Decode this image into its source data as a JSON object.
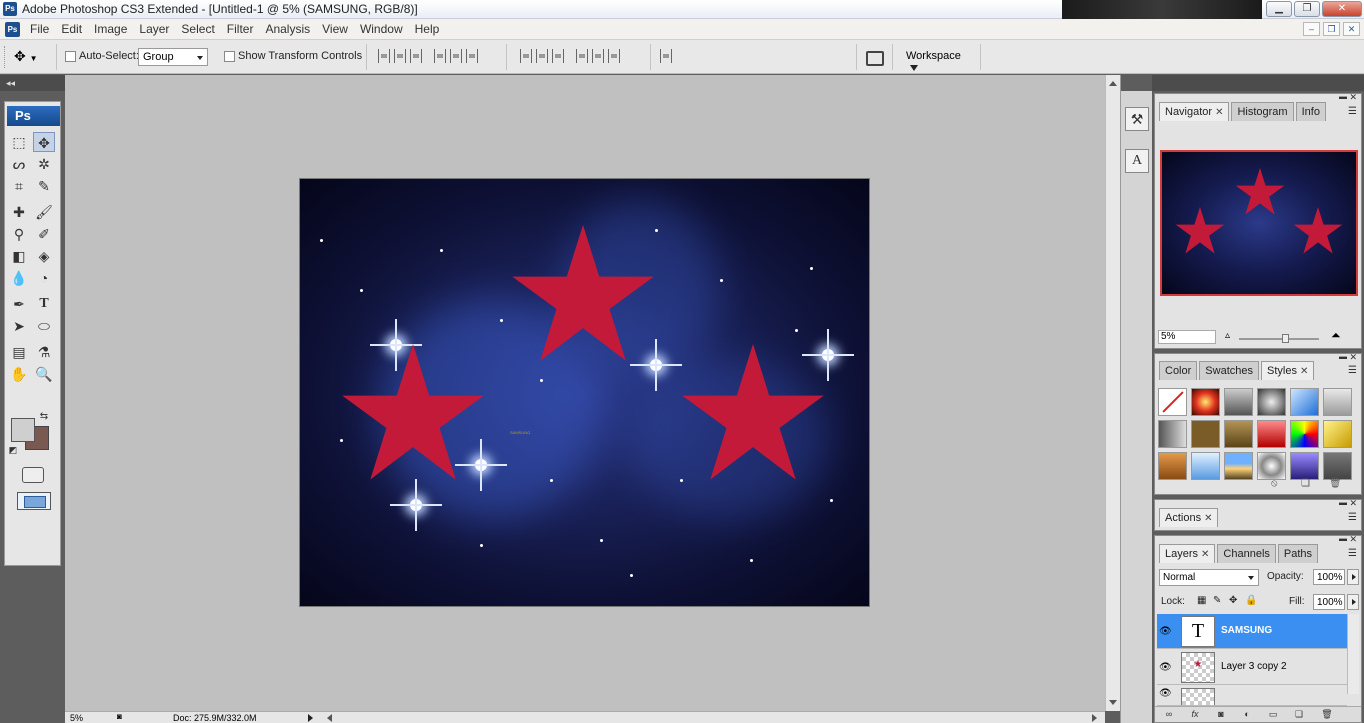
{
  "window": {
    "title": "Adobe Photoshop CS3 Extended - [Untitled-1 @ 5% (SAMSUNG, RGB/8)]",
    "app_icon": "Ps",
    "controls": [
      "minimize",
      "maximize",
      "close"
    ]
  },
  "menubar": {
    "items": [
      "File",
      "Edit",
      "Image",
      "Layer",
      "Select",
      "Filter",
      "Analysis",
      "View",
      "Window",
      "Help"
    ]
  },
  "options": {
    "auto_select_label": "Auto-Select:",
    "auto_select_value": "Group",
    "show_transform_label": "Show Transform Controls",
    "workspace_label": "Workspace"
  },
  "tools": {
    "logo": "Ps",
    "items": [
      "marquee-icon",
      "move-icon",
      "lasso-icon",
      "magic-wand-icon",
      "crop-icon",
      "slice-icon",
      "healing-brush-icon",
      "brush-icon",
      "clone-stamp-icon",
      "history-brush-icon",
      "eraser-icon",
      "paint-bucket-icon",
      "blur-icon",
      "dodge-icon",
      "pen-icon",
      "type-icon",
      "path-selection-icon",
      "ellipse-icon",
      "notes-icon",
      "eyedropper-icon",
      "hand-icon",
      "zoom-icon"
    ],
    "foreground_color": "#cfcfcf",
    "background_color": "#7a5a50"
  },
  "canvas": {
    "text_layer": "SAMSUNG",
    "star_color": "#c41a3a"
  },
  "status": {
    "zoom": "5%",
    "doc": "Doc: 275.9M/332.0M"
  },
  "navigator_panel": {
    "tabs": [
      "Navigator",
      "Histogram",
      "Info"
    ],
    "zoom": "5%"
  },
  "styles_panel": {
    "tabs": [
      "Color",
      "Swatches",
      "Styles"
    ]
  },
  "actions_panel": {
    "tabs": [
      "Actions"
    ]
  },
  "layers_panel": {
    "tabs": [
      "Layers",
      "Channels",
      "Paths"
    ],
    "blend_mode": "Normal",
    "opacity_label": "Opacity:",
    "opacity": "100%",
    "lock_label": "Lock:",
    "fill_label": "Fill:",
    "fill": "100%",
    "layers": [
      {
        "name": "SAMSUNG",
        "selected": true
      },
      {
        "name": "Layer 3 copy 2",
        "selected": false
      }
    ]
  }
}
